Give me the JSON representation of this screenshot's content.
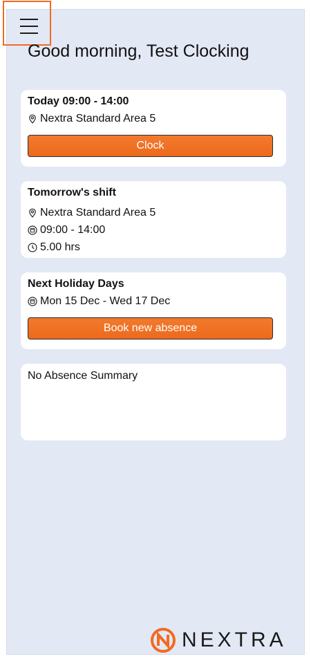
{
  "header": {
    "menu_icon": "hamburger-menu-icon",
    "greeting": "Good morning, Test Clocking"
  },
  "today": {
    "title": "Today 09:00 - 14:00",
    "location": "Nextra Standard Area 5",
    "clock_label": "Clock"
  },
  "tomorrow": {
    "title": "Tomorrow's shift",
    "location": "Nextra Standard Area 5",
    "time": "09:00 - 14:00",
    "hours": "5.00 hrs"
  },
  "holiday": {
    "title": "Next Holiday Days",
    "dates": "Mon 15 Dec - Wed 17 Dec",
    "book_label": "Book new absence"
  },
  "absence_summary": {
    "text": "No Absence Summary"
  },
  "brand": {
    "name": "NEXTRA",
    "accent": "#f26a21"
  }
}
